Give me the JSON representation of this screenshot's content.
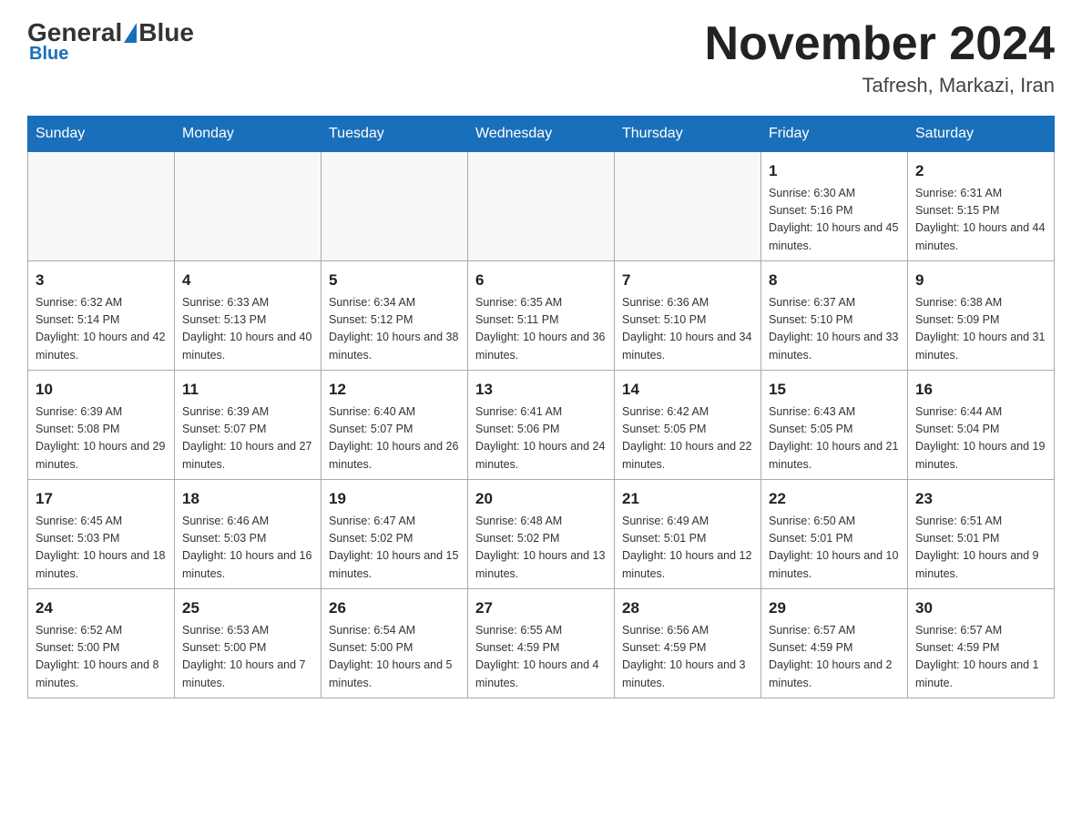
{
  "header": {
    "logo_general": "General",
    "logo_blue": "Blue",
    "month_title": "November 2024",
    "location": "Tafresh, Markazi, Iran"
  },
  "weekdays": [
    "Sunday",
    "Monday",
    "Tuesday",
    "Wednesday",
    "Thursday",
    "Friday",
    "Saturday"
  ],
  "weeks": [
    [
      {
        "day": "",
        "info": ""
      },
      {
        "day": "",
        "info": ""
      },
      {
        "day": "",
        "info": ""
      },
      {
        "day": "",
        "info": ""
      },
      {
        "day": "",
        "info": ""
      },
      {
        "day": "1",
        "info": "Sunrise: 6:30 AM\nSunset: 5:16 PM\nDaylight: 10 hours and 45 minutes."
      },
      {
        "day": "2",
        "info": "Sunrise: 6:31 AM\nSunset: 5:15 PM\nDaylight: 10 hours and 44 minutes."
      }
    ],
    [
      {
        "day": "3",
        "info": "Sunrise: 6:32 AM\nSunset: 5:14 PM\nDaylight: 10 hours and 42 minutes."
      },
      {
        "day": "4",
        "info": "Sunrise: 6:33 AM\nSunset: 5:13 PM\nDaylight: 10 hours and 40 minutes."
      },
      {
        "day": "5",
        "info": "Sunrise: 6:34 AM\nSunset: 5:12 PM\nDaylight: 10 hours and 38 minutes."
      },
      {
        "day": "6",
        "info": "Sunrise: 6:35 AM\nSunset: 5:11 PM\nDaylight: 10 hours and 36 minutes."
      },
      {
        "day": "7",
        "info": "Sunrise: 6:36 AM\nSunset: 5:10 PM\nDaylight: 10 hours and 34 minutes."
      },
      {
        "day": "8",
        "info": "Sunrise: 6:37 AM\nSunset: 5:10 PM\nDaylight: 10 hours and 33 minutes."
      },
      {
        "day": "9",
        "info": "Sunrise: 6:38 AM\nSunset: 5:09 PM\nDaylight: 10 hours and 31 minutes."
      }
    ],
    [
      {
        "day": "10",
        "info": "Sunrise: 6:39 AM\nSunset: 5:08 PM\nDaylight: 10 hours and 29 minutes."
      },
      {
        "day": "11",
        "info": "Sunrise: 6:39 AM\nSunset: 5:07 PM\nDaylight: 10 hours and 27 minutes."
      },
      {
        "day": "12",
        "info": "Sunrise: 6:40 AM\nSunset: 5:07 PM\nDaylight: 10 hours and 26 minutes."
      },
      {
        "day": "13",
        "info": "Sunrise: 6:41 AM\nSunset: 5:06 PM\nDaylight: 10 hours and 24 minutes."
      },
      {
        "day": "14",
        "info": "Sunrise: 6:42 AM\nSunset: 5:05 PM\nDaylight: 10 hours and 22 minutes."
      },
      {
        "day": "15",
        "info": "Sunrise: 6:43 AM\nSunset: 5:05 PM\nDaylight: 10 hours and 21 minutes."
      },
      {
        "day": "16",
        "info": "Sunrise: 6:44 AM\nSunset: 5:04 PM\nDaylight: 10 hours and 19 minutes."
      }
    ],
    [
      {
        "day": "17",
        "info": "Sunrise: 6:45 AM\nSunset: 5:03 PM\nDaylight: 10 hours and 18 minutes."
      },
      {
        "day": "18",
        "info": "Sunrise: 6:46 AM\nSunset: 5:03 PM\nDaylight: 10 hours and 16 minutes."
      },
      {
        "day": "19",
        "info": "Sunrise: 6:47 AM\nSunset: 5:02 PM\nDaylight: 10 hours and 15 minutes."
      },
      {
        "day": "20",
        "info": "Sunrise: 6:48 AM\nSunset: 5:02 PM\nDaylight: 10 hours and 13 minutes."
      },
      {
        "day": "21",
        "info": "Sunrise: 6:49 AM\nSunset: 5:01 PM\nDaylight: 10 hours and 12 minutes."
      },
      {
        "day": "22",
        "info": "Sunrise: 6:50 AM\nSunset: 5:01 PM\nDaylight: 10 hours and 10 minutes."
      },
      {
        "day": "23",
        "info": "Sunrise: 6:51 AM\nSunset: 5:01 PM\nDaylight: 10 hours and 9 minutes."
      }
    ],
    [
      {
        "day": "24",
        "info": "Sunrise: 6:52 AM\nSunset: 5:00 PM\nDaylight: 10 hours and 8 minutes."
      },
      {
        "day": "25",
        "info": "Sunrise: 6:53 AM\nSunset: 5:00 PM\nDaylight: 10 hours and 7 minutes."
      },
      {
        "day": "26",
        "info": "Sunrise: 6:54 AM\nSunset: 5:00 PM\nDaylight: 10 hours and 5 minutes."
      },
      {
        "day": "27",
        "info": "Sunrise: 6:55 AM\nSunset: 4:59 PM\nDaylight: 10 hours and 4 minutes."
      },
      {
        "day": "28",
        "info": "Sunrise: 6:56 AM\nSunset: 4:59 PM\nDaylight: 10 hours and 3 minutes."
      },
      {
        "day": "29",
        "info": "Sunrise: 6:57 AM\nSunset: 4:59 PM\nDaylight: 10 hours and 2 minutes."
      },
      {
        "day": "30",
        "info": "Sunrise: 6:57 AM\nSunset: 4:59 PM\nDaylight: 10 hours and 1 minute."
      }
    ]
  ]
}
